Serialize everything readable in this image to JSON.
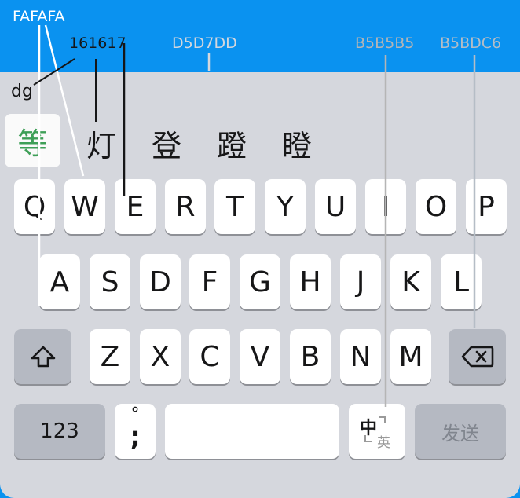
{
  "annotations": {
    "key_color": "FAFAFA",
    "text_color": "161617",
    "bg_color": "D5D7DD",
    "line_color": "B5B5B5",
    "fn_color": "B5BDC6"
  },
  "pinyin": "dg",
  "candidates": [
    "等",
    "灯",
    "登",
    "蹬",
    "瞪"
  ],
  "rows": {
    "row1": [
      "Q",
      "W",
      "E",
      "R",
      "T",
      "Y",
      "U",
      "I",
      "O",
      "P"
    ],
    "row2": [
      "A",
      "S",
      "D",
      "F",
      "G",
      "H",
      "J",
      "K",
      "L"
    ],
    "row3": [
      "Z",
      "X",
      "C",
      "V",
      "B",
      "N",
      "M"
    ]
  },
  "bottom": {
    "num_label": "123",
    "punct_top": "°",
    "punct_bottom": ";",
    "lang_top": "中",
    "lang_bottom": "英",
    "send_label": "发送"
  },
  "colors": {
    "header_bg": "#0A92F0",
    "keyboard_bg": "#D5D7DD",
    "key_bg": "#FFFFFF",
    "fn_key_bg": "#B5B9C2",
    "selected_candidate": "#3E9F57"
  }
}
